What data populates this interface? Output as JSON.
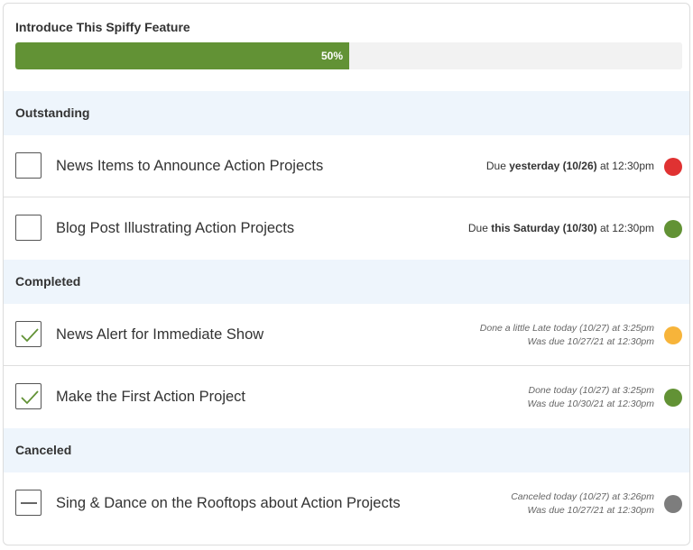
{
  "feature": {
    "title": "Introduce This Spiffy Feature",
    "progress_label": "50%",
    "progress_percent": 50
  },
  "colors": {
    "progress": "#629235",
    "overdue": "#e03232",
    "on_time": "#629235",
    "late": "#f7b43a",
    "canceled": "#7d7d7d"
  },
  "sections": {
    "outstanding": {
      "title": "Outstanding",
      "items": [
        {
          "label": "News Items to Announce Action Projects",
          "due_prefix": "Due ",
          "due_emphasis": "yesterday (10/26)",
          "due_suffix": " at 12:30pm",
          "status_color": "#e03232"
        },
        {
          "label": "Blog Post Illustrating Action Projects",
          "due_prefix": "Due ",
          "due_emphasis": "this Saturday (10/30)",
          "due_suffix": " at 12:30pm",
          "status_color": "#629235"
        }
      ]
    },
    "completed": {
      "title": "Completed",
      "items": [
        {
          "label": "News Alert for Immediate Show",
          "meta_line1": "Done a little Late today (10/27) at 3:25pm",
          "meta_line2": "Was due 10/27/21 at 12:30pm",
          "status_color": "#f7b43a"
        },
        {
          "label": "Make the First Action Project",
          "meta_line1": "Done today (10/27) at 3:25pm",
          "meta_line2": "Was due 10/30/21 at 12:30pm",
          "status_color": "#629235"
        }
      ]
    },
    "canceled": {
      "title": "Canceled",
      "items": [
        {
          "label": "Sing & Dance on the Rooftops about Action Projects",
          "meta_line1": "Canceled today (10/27) at 3:26pm",
          "meta_line2": "Was due 10/27/21 at 12:30pm",
          "status_color": "#7d7d7d"
        }
      ]
    }
  }
}
